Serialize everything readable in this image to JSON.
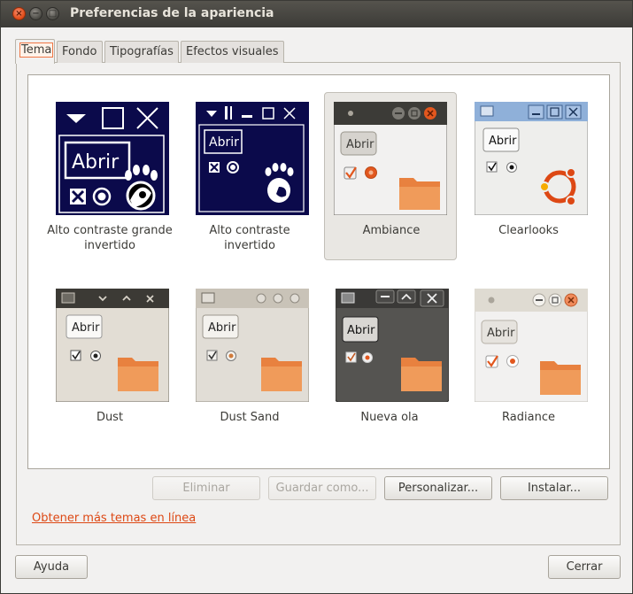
{
  "window": {
    "title": "Preferencias de la apariencia",
    "close_glyph": "×",
    "minimize_glyph": "−",
    "maximize_glyph": "□"
  },
  "tabs": [
    {
      "label": "Tema",
      "active": true
    },
    {
      "label": "Fondo",
      "active": false
    },
    {
      "label": "Tipografías",
      "active": false
    },
    {
      "label": "Efectos visuales",
      "active": false
    }
  ],
  "themes": [
    {
      "name": "Alto contraste grande invertido",
      "icon": "high-contrast-large-inverse-preview",
      "selected": false
    },
    {
      "name": "Alto contraste invertido",
      "icon": "high-contrast-inverse-preview",
      "selected": false
    },
    {
      "name": "Ambiance",
      "icon": "ambiance-preview",
      "selected": true
    },
    {
      "name": "Clearlooks",
      "icon": "clearlooks-preview",
      "selected": false
    },
    {
      "name": "Dust",
      "icon": "dust-preview",
      "selected": false
    },
    {
      "name": "Dust Sand",
      "icon": "dust-sand-preview",
      "selected": false
    },
    {
      "name": "Nueva ola",
      "icon": "new-wave-preview",
      "selected": false
    },
    {
      "name": "Radiance",
      "icon": "radiance-preview",
      "selected": false
    }
  ],
  "preview_button_label": "Abrir",
  "actions": {
    "delete": "Eliminar",
    "save_as": "Guardar como...",
    "customize": "Personalizar...",
    "install": "Instalar..."
  },
  "more_themes_link": "Obtener más temas en línea",
  "footer": {
    "help": "Ayuda",
    "close": "Cerrar"
  },
  "colors": {
    "accent_orange": "#f07746",
    "link": "#dd4814",
    "titlebar": "#3c3b37",
    "high_contrast_bg": "#0b0a4b"
  }
}
